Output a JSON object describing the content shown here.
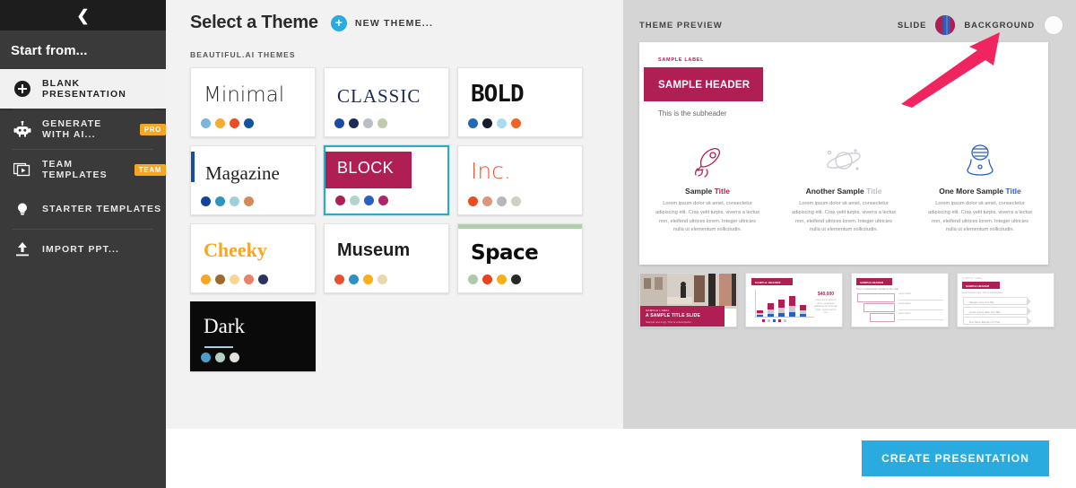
{
  "sidebar": {
    "collapse_icon": "chevron-left-icon",
    "heading": "Start from...",
    "items": [
      {
        "label": "BLANK PRESENTATION",
        "icon": "plus-circle-icon",
        "active": true,
        "badge": ""
      },
      {
        "label": "GENERATE WITH AI...",
        "icon": "robot-icon",
        "active": false,
        "badge": "PRO"
      },
      {
        "label": "TEAM TEMPLATES",
        "icon": "slides-icon",
        "active": false,
        "badge": "TEAM"
      },
      {
        "label": "STARTER TEMPLATES",
        "icon": "lightbulb-icon",
        "active": false,
        "badge": ""
      },
      {
        "label": "IMPORT PPT...",
        "icon": "upload-icon",
        "active": false,
        "badge": ""
      }
    ]
  },
  "themes_panel": {
    "title": "Select a Theme",
    "new_theme_label": "NEW THEME...",
    "new_theme_icon": "plus-circle-icon",
    "section_label": "BEAUTIFUL.AI THEMES",
    "cards": [
      {
        "name": "Minimal",
        "style": "minimal",
        "selected": false,
        "swatches": [
          "#7cb5d8",
          "#f5ab2e",
          "#ea4f23",
          "#12539e"
        ]
      },
      {
        "name": "CLASSIC",
        "style": "classic",
        "selected": false,
        "swatches": [
          "#1b4b9e",
          "#1c2b56",
          "#b8bec4",
          "#c0cbab"
        ]
      },
      {
        "name": "BOLD",
        "style": "bold",
        "selected": false,
        "swatches": [
          "#2467b5",
          "#171b2c",
          "#a6dcf0",
          "#ef6326"
        ]
      },
      {
        "name": "Magazine",
        "style": "magazine",
        "selected": false,
        "swatches": [
          "#11459a",
          "#2f95bf",
          "#9ed0dc",
          "#d38a5a"
        ],
        "accent": "#1b4b9e"
      },
      {
        "name": "BLOCK",
        "style": "block",
        "selected": true,
        "swatches": [
          "#b01f54",
          "#b7d2cc",
          "#2a5fc0",
          "#b0246a"
        ],
        "accent": "#b01f54"
      },
      {
        "name": "Inc.",
        "style": "inc",
        "selected": false,
        "swatches": [
          "#ea4f23",
          "#d9957f",
          "#b7b7b7",
          "#ccd2c4"
        ]
      },
      {
        "name": "Cheeky",
        "style": "cheeky",
        "selected": false,
        "swatches": [
          "#f5a623",
          "#9b6b2c",
          "#f6d79a",
          "#e8826a",
          "#2b3559"
        ]
      },
      {
        "name": "Museum",
        "style": "museum",
        "selected": false,
        "swatches": [
          "#e85130",
          "#2e8fc4",
          "#f5b01e",
          "#e8d9ac"
        ]
      },
      {
        "name": "Space",
        "style": "space",
        "selected": false,
        "swatches": [
          "#adc9a8",
          "#e8431f",
          "#f5b01e",
          "#26292c"
        ],
        "accent": "#b3ceae"
      },
      {
        "name": "Dark",
        "style": "dark",
        "selected": false,
        "swatches": [
          "#4a9dc9",
          "#b2d0c8",
          "#e2e2dc"
        ],
        "accent": "#a9cfe0"
      }
    ]
  },
  "preview": {
    "label": "THEME PREVIEW",
    "slide_toggle_label": "SLIDE",
    "slide_toggle_icon": "color-swatch-circle-icon",
    "background_toggle_label": "BACKGROUND",
    "background_toggle_icon": "white-swatch-circle-icon",
    "annotation_arrow_icon": "arrow-pointer-icon",
    "annotation_arrow_color": "#f0255f",
    "slide": {
      "label": "SAMPLE LABEL",
      "header": "SAMPLE HEADER",
      "subheader": "This is the subheader",
      "accent_color": "#b01f54",
      "columns": [
        {
          "icon": "rocket-icon",
          "icon_color": "#b01f54",
          "title_plain": "Sample ",
          "title_accent": "Title",
          "title_accent_color": "#b01f54",
          "body": "Lorem ipsum dolor sit amet, consectetur adipiscing elit. Cras velit turpis, viverra a lectus non, eleifend ultrices lorem. Integer ultricies nulla ut elementum sollicitudin."
        },
        {
          "icon": "planet-icon",
          "icon_color": "#c9ccd1",
          "title_plain": "Another Sample ",
          "title_accent": "Title",
          "title_accent_color": "#b9bec6",
          "body": "Lorem ipsum dolor sit amet, consectetur adipiscing elit. Cras velit turpis, viverra a lectus non, eleifend ultrices lorem. Integer ultricies nulla ut elementum sollicitudin."
        },
        {
          "icon": "astronaut-helmet-icon",
          "icon_color": "#2a5fc0",
          "title_plain": "One More Sample ",
          "title_accent": "Title",
          "title_accent_color": "#2a5fc0",
          "body": "Lorem ipsum dolor sit amet, consectetur adipiscing elit. Cras velit turpis, viverra a lectus non, eleifend ultrices lorem. Integer ultricies nulla ut elementum sollicitudin."
        }
      ]
    },
    "thumbnails": [
      {
        "kind": "photo-title-slide",
        "label": "SAMPLE LABEL",
        "title": "A SAMPLE TITLE SLIDE",
        "subtitle": "Sample text copy. This is a description."
      },
      {
        "kind": "bar-chart-slide",
        "header": "SAMPLE HEADER",
        "value": "$40,000",
        "caption": "Lorem ipsum dolor sit amet, consectetur adipiscing elit. Cras velit turpis, viverra a lectus non."
      },
      {
        "kind": "funnel-slide",
        "header": "SAMPLE HEADER",
        "subtitle": "This is a placeholder subtitle for the slide"
      },
      {
        "kind": "chevron-list-slide",
        "header": "SAMPLE HEADER",
        "eyebrow": "SAMPLE LABEL",
        "subtitle": "Lorem ipsum copy. This is a description.",
        "rows": [
          "Sample copy of a Title",
          "Lorem ipsum dolor of a Title",
          "One More Sample of a Title"
        ]
      }
    ]
  },
  "footer": {
    "create_button": "CREATE PRESENTATION",
    "create_button_color": "#29abe0"
  },
  "chart_data": {
    "type": "bar",
    "title": "SAMPLE HEADER",
    "categories": [
      "2017",
      "2018",
      "2019",
      "2020",
      "2021"
    ],
    "series": [
      {
        "name": "Series 1",
        "values": [
          4,
          10,
          13,
          15,
          9
        ]
      },
      {
        "name": "Series 2",
        "values": [
          3,
          7,
          9,
          11,
          6
        ]
      },
      {
        "name": "Series 3",
        "values": [
          2,
          5,
          6,
          8,
          4
        ]
      }
    ],
    "ylabel": "",
    "xlabel": "",
    "legend": "bottom"
  }
}
